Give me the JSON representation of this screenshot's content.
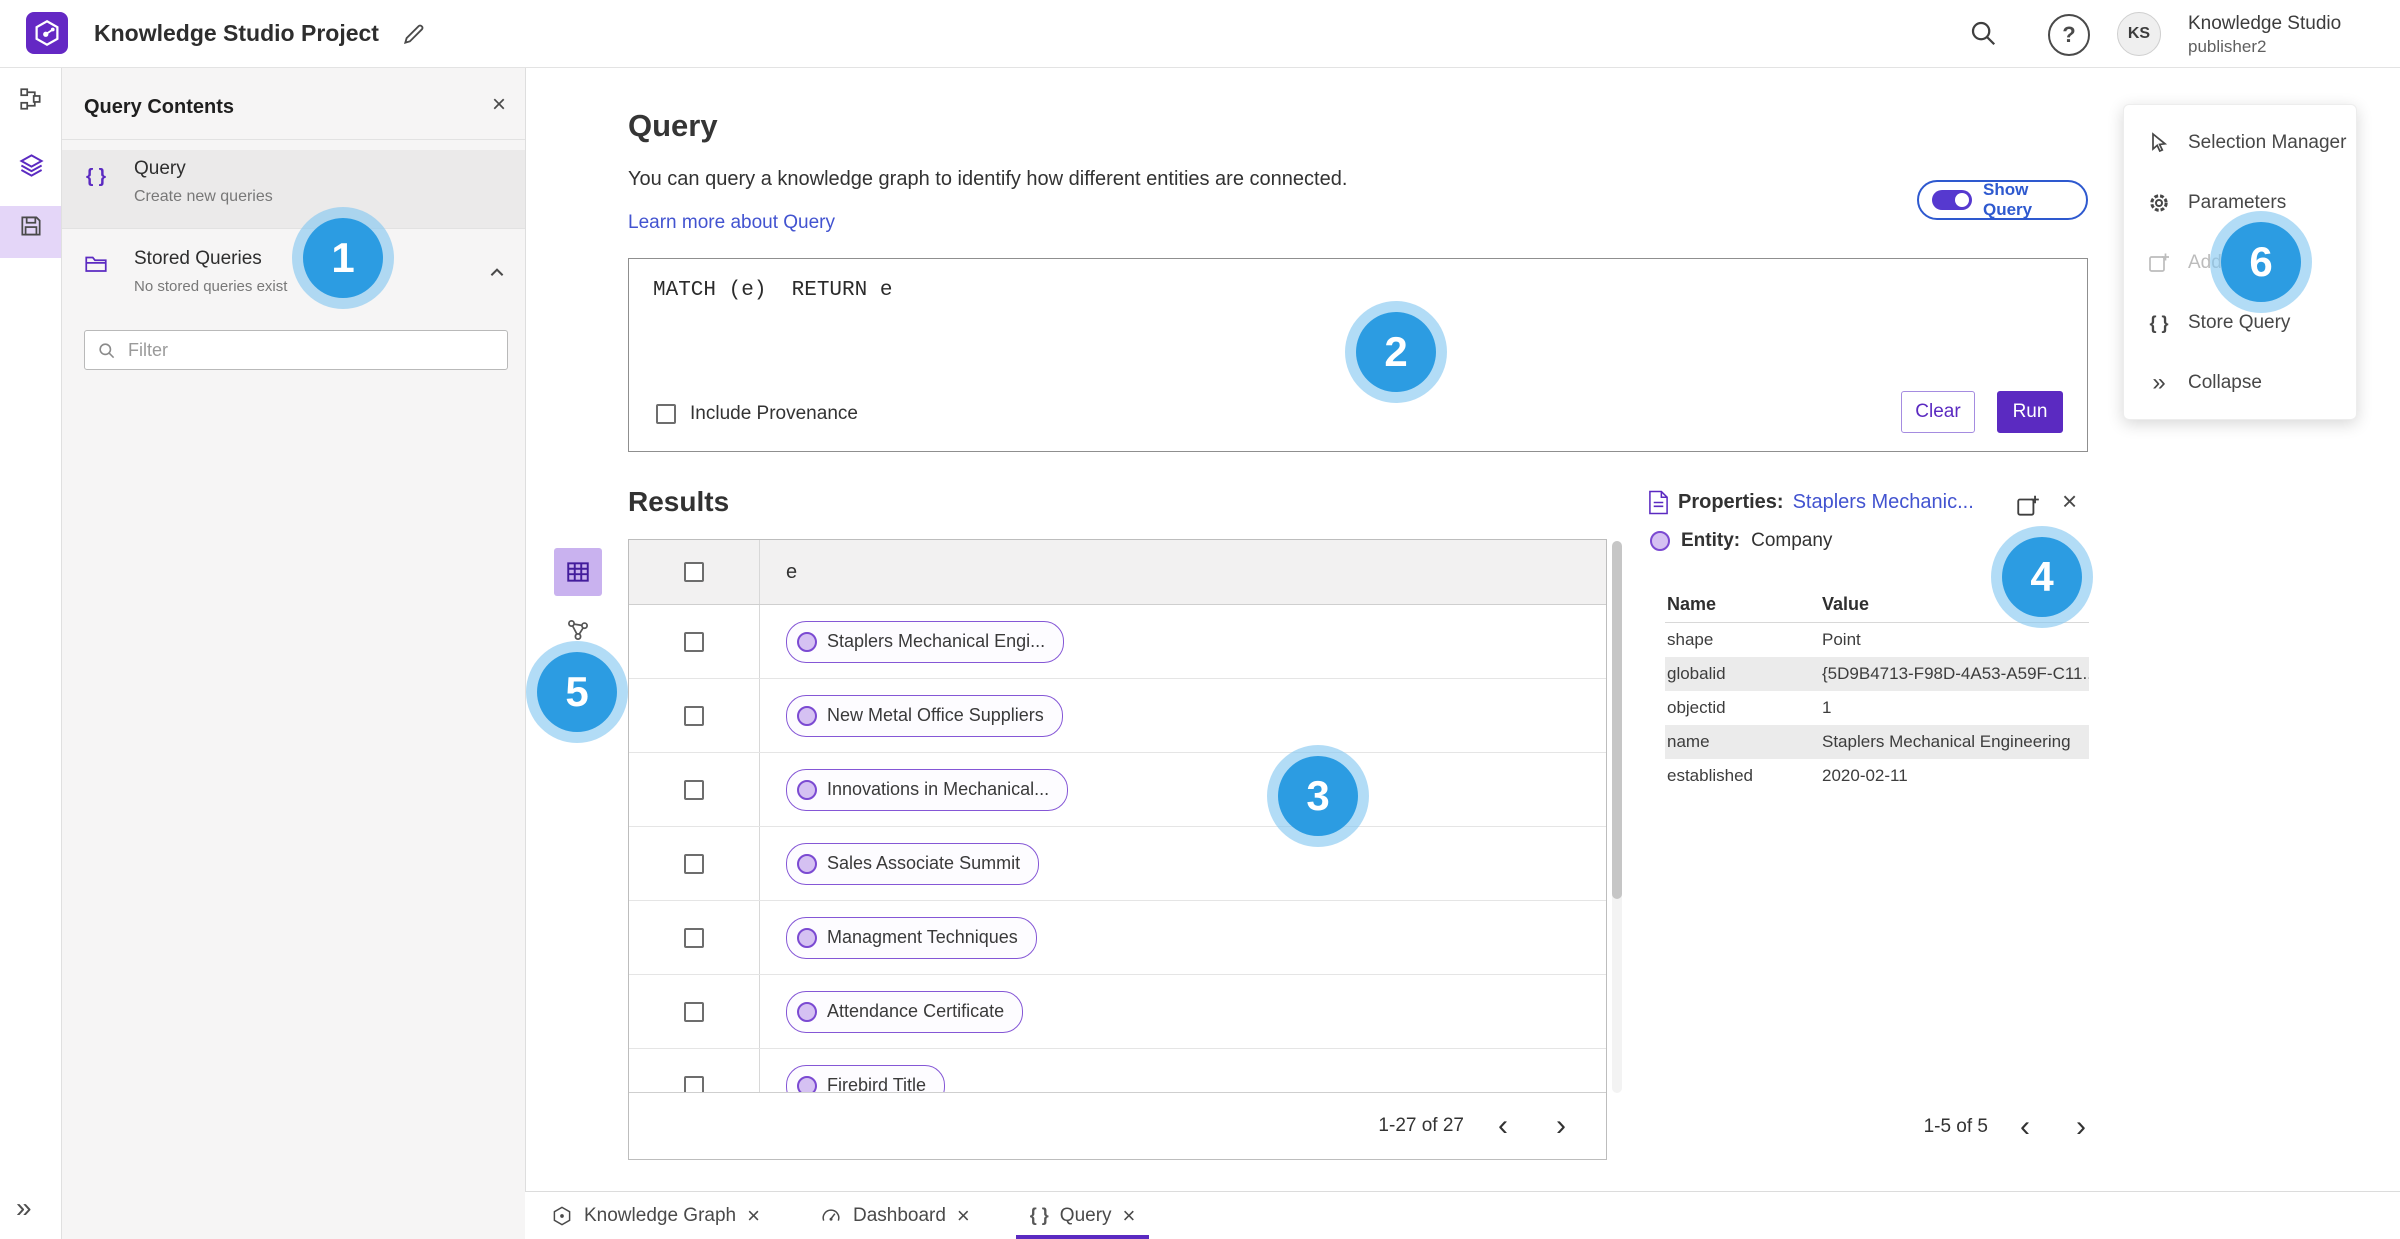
{
  "topbar": {
    "title": "Knowledge Studio Project",
    "user_initials": "KS",
    "user_name": "Knowledge Studio",
    "user_role": "publisher2"
  },
  "left_panel": {
    "title": "Query Contents",
    "query_item": {
      "label": "Query",
      "sublabel": "Create new queries",
      "icon_text": "{ }"
    },
    "stored_queries": {
      "label": "Stored Queries",
      "sublabel": "No stored queries exist"
    },
    "filter_placeholder": "Filter"
  },
  "query_section": {
    "heading": "Query",
    "description": "You can query a knowledge graph to identify how different entities are connected.",
    "learn_more_link": "Learn more about Query",
    "show_query_label": "Show Query",
    "query_text": "MATCH (e)  RETURN e",
    "include_provenance_label": "Include Provenance",
    "clear_button": "Clear",
    "run_button": "Run"
  },
  "results": {
    "heading": "Results",
    "column_e": "e",
    "rows": [
      "Staplers Mechanical Engi...",
      "New Metal Office Suppliers",
      "Innovations in Mechanical...",
      "Sales Associate Summit",
      "Managment Techniques",
      "Attendance Certificate",
      "Firebird Title"
    ],
    "pagination": "1-27 of 27"
  },
  "properties": {
    "label": "Properties:",
    "entity_name_link": "Staplers Mechanic...",
    "entity_label": "Entity:",
    "entity_type": "Company",
    "col_name": "Name",
    "col_value": "Value",
    "rows": [
      {
        "name": "shape",
        "value": "Point"
      },
      {
        "name": "globalid",
        "value": "{5D9B4713-F98D-4A53-A59F-C11..."
      },
      {
        "name": "objectid",
        "value": "1"
      },
      {
        "name": "name",
        "value": "Staplers Mechanical Engineering"
      },
      {
        "name": "established",
        "value": "2020-02-11"
      }
    ],
    "pagination": "1-5 of 5"
  },
  "side_menu": {
    "item_selection_manager": "Selection Manager",
    "item_parameters": "Parameters",
    "item_add": "Add",
    "item_store_query": "Store Query",
    "item_collapse": "Collapse",
    "store_query_icon_text": "{ }",
    "collapse_icon_text": "»"
  },
  "tabs": {
    "knowledge_graph": "Knowledge Graph",
    "dashboard": "Dashboard",
    "query": "Query",
    "query_icon_text": "{ }"
  },
  "badges": [
    "1",
    "2",
    "3",
    "4",
    "5",
    "6"
  ],
  "misc": {
    "rail_collapse_text": "»",
    "prev_glyph": "‹",
    "next_glyph": "›",
    "close_glyph": "×",
    "help_glyph": "?"
  },
  "colors": {
    "accent_purple": "#5b2ac1",
    "link_blue": "#4253d0",
    "badge_blue": "#2c9ce2"
  }
}
